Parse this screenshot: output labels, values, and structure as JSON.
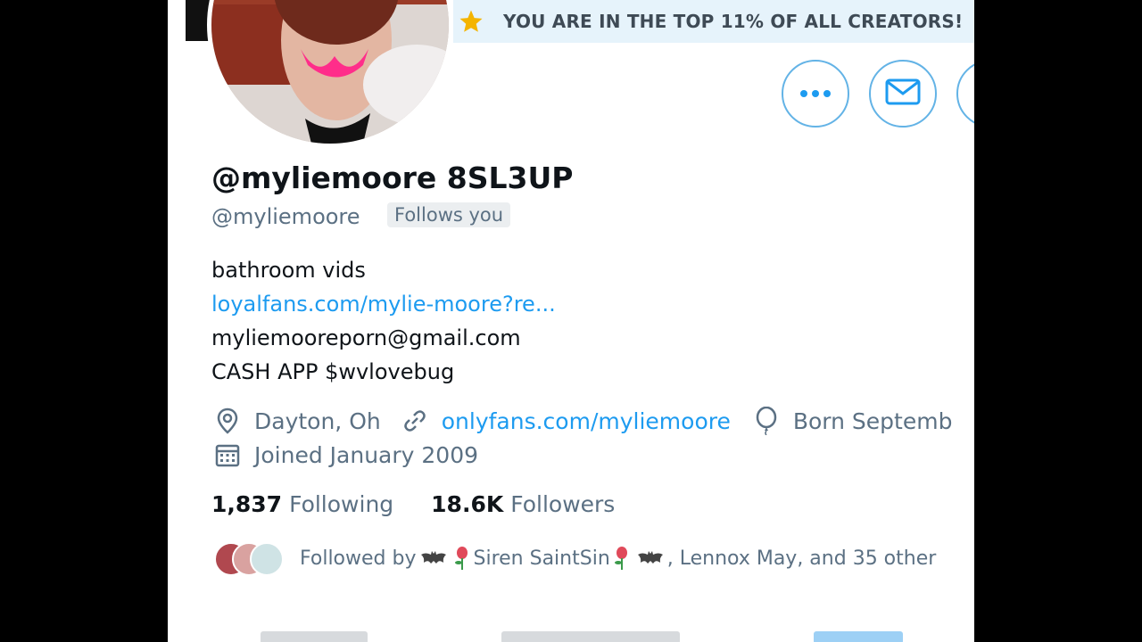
{
  "banner": {
    "text": "YOU ARE IN THE TOP 11% OF ALL CREATORS!",
    "star_color": "#f4b400"
  },
  "profile": {
    "display_name": "@myliemoore 8SL3UP",
    "handle": "@myliemoore",
    "follows_you": "Follows you",
    "bio": {
      "line1": "bathroom vids",
      "link": "loyalfans.com/mylie-moore?re...",
      "email": "myliemooreporn@gmail.com",
      "cash": "CASH APP $wvlovebug"
    },
    "meta": {
      "location": "Dayton, Oh",
      "website": "onlyfans.com/myliemoore",
      "birthday": "Born Septemb",
      "joined": "Joined January 2009"
    },
    "stats": {
      "following_count": "1,837",
      "following_label": "Following",
      "followers_count": "18.6K",
      "followers_label": "Followers"
    },
    "followed_by": {
      "prefix": "Followed by",
      "name1": "Siren SaintSin",
      "rest": ", Lennox May, and 35 other"
    }
  },
  "actions": {
    "more_icon": "more-dots-icon",
    "message_icon": "envelope-icon",
    "notify_icon": "bell-icon"
  },
  "colors": {
    "accent": "#1d9bf0",
    "muted": "#5b7083",
    "banner_bg": "#e6f3fb"
  }
}
